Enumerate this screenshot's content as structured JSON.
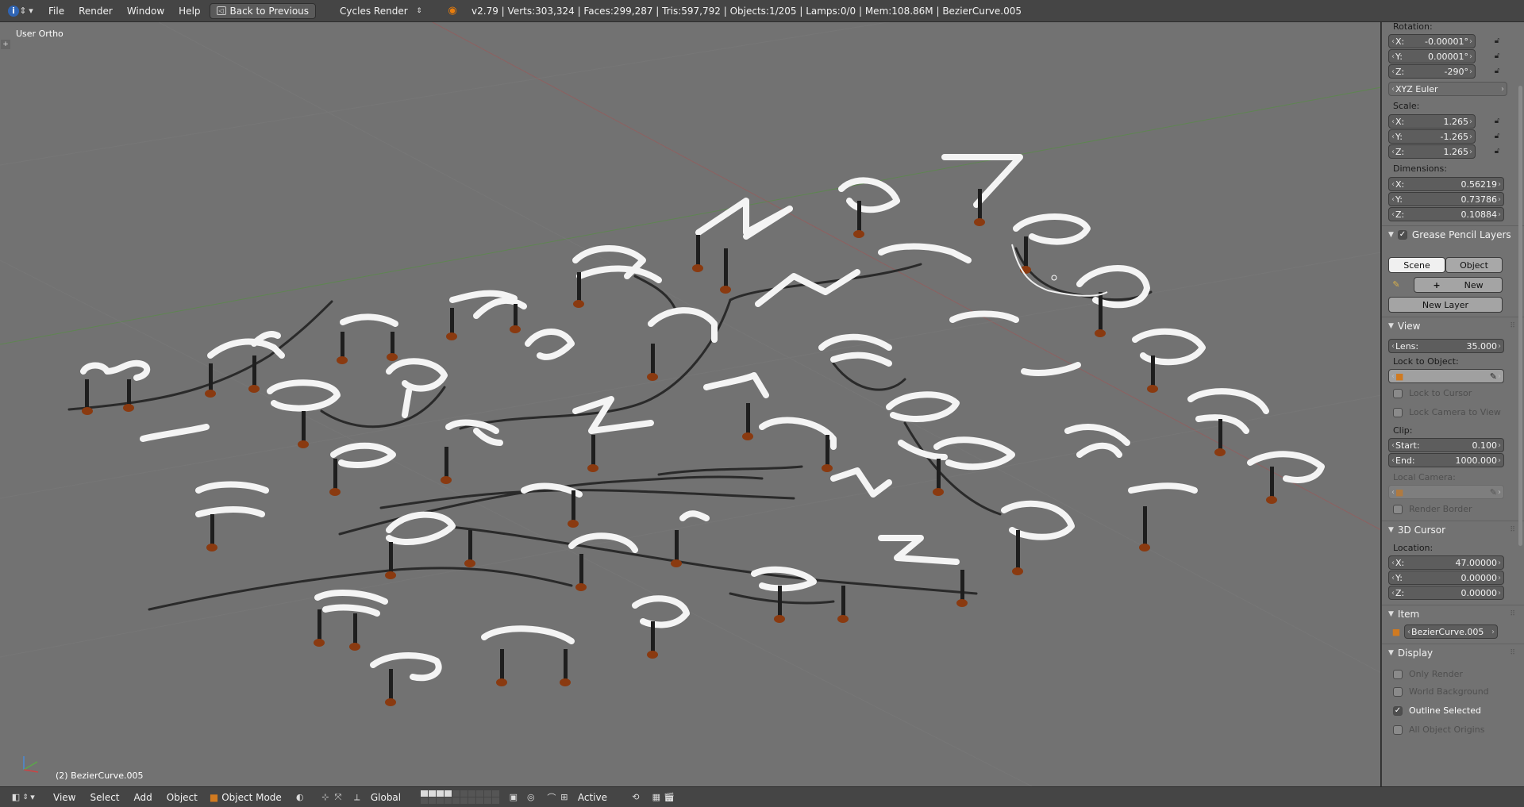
{
  "topbar": {
    "menus": [
      "File",
      "Render",
      "Window",
      "Help"
    ],
    "back_button": "Back to Previous",
    "render_engine": "Cycles Render",
    "stats": "v2.79 | Verts:303,324 | Faces:299,287 | Tris:597,792 | Objects:1/205 | Lamps:0/0 | Mem:108.86M | BezierCurve.005"
  },
  "viewport": {
    "view_name": "User Ortho",
    "active_object_label": "(2) BezierCurve.005"
  },
  "sidebar": {
    "rotation_label": "Rotation:",
    "rotation": [
      {
        "axis": "X:",
        "value": "-0.00001°"
      },
      {
        "axis": "Y:",
        "value": "0.00001°"
      },
      {
        "axis": "Z:",
        "value": "-290°"
      }
    ],
    "rotation_mode": "XYZ Euler",
    "scale_label": "Scale:",
    "scale": [
      {
        "axis": "X:",
        "value": "1.265"
      },
      {
        "axis": "Y:",
        "value": "-1.265"
      },
      {
        "axis": "Z:",
        "value": "1.265"
      }
    ],
    "dimensions_label": "Dimensions:",
    "dimensions": [
      {
        "axis": "X:",
        "value": "0.56219"
      },
      {
        "axis": "Y:",
        "value": "0.73786"
      },
      {
        "axis": "Z:",
        "value": "0.10884"
      }
    ],
    "grease_pencil": {
      "title": "Grease Pencil Layers",
      "enabled": true,
      "tabs": [
        "Scene",
        "Object"
      ],
      "active_tab": "Scene",
      "new_label": "New",
      "new_layer_label": "New Layer"
    },
    "view_panel": {
      "title": "View",
      "lens_label": "Lens:",
      "lens_value": "35.000",
      "lock_to_object_label": "Lock to Object:",
      "lock_to_cursor": "Lock to Cursor",
      "lock_camera": "Lock Camera to View",
      "clip_label": "Clip:",
      "clip_start_label": "Start:",
      "clip_start": "0.100",
      "clip_end_label": "End:",
      "clip_end": "1000.000",
      "local_camera_label": "Local Camera:",
      "render_border": "Render Border"
    },
    "cursor_panel": {
      "title": "3D Cursor",
      "location_label": "Location:",
      "location": [
        {
          "axis": "X:",
          "value": "47.00000"
        },
        {
          "axis": "Y:",
          "value": "0.00000"
        },
        {
          "axis": "Z:",
          "value": "0.00000"
        }
      ]
    },
    "item_panel": {
      "title": "Item",
      "name": "BezierCurve.005"
    },
    "display_panel": {
      "title": "Display",
      "options": [
        {
          "label": "Only Render",
          "checked": false
        },
        {
          "label": "World Background",
          "checked": false
        },
        {
          "label": "Outline Selected",
          "checked": true
        },
        {
          "label": "All Object Origins",
          "checked": false
        }
      ]
    }
  },
  "botbar": {
    "menus": [
      "View",
      "Select",
      "Add",
      "Object"
    ],
    "mode": "Object Mode",
    "orientation": "Global",
    "pivot": "Active"
  },
  "colors": {
    "viewport_bg": "#727272",
    "header_bg": "#454545",
    "tube_white": "#f4f4f4",
    "dark_wire": "#2a2a2a",
    "copper": "#8a3a10",
    "grid_x": "#a05555",
    "grid_y": "#5a8a4a"
  }
}
